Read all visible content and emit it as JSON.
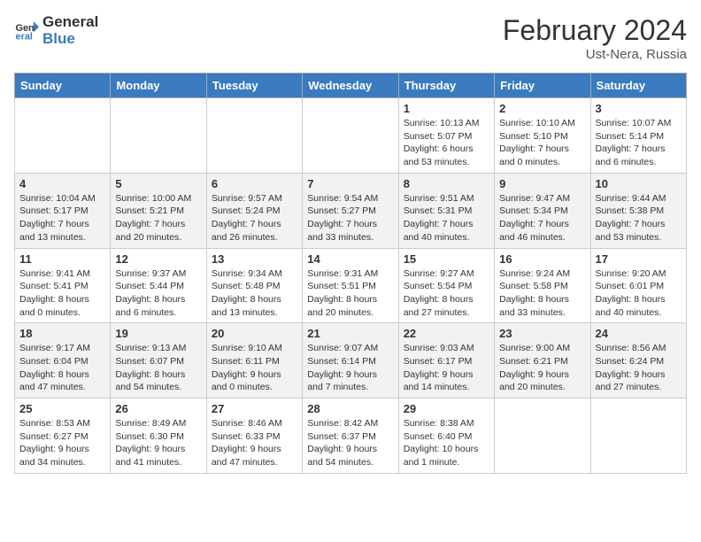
{
  "logo": {
    "line1": "General",
    "line2": "Blue"
  },
  "header": {
    "month": "February 2024",
    "location": "Ust-Nera, Russia"
  },
  "days_of_week": [
    "Sunday",
    "Monday",
    "Tuesday",
    "Wednesday",
    "Thursday",
    "Friday",
    "Saturday"
  ],
  "weeks": [
    [
      {
        "day": "",
        "info": ""
      },
      {
        "day": "",
        "info": ""
      },
      {
        "day": "",
        "info": ""
      },
      {
        "day": "",
        "info": ""
      },
      {
        "day": "1",
        "info": "Sunrise: 10:13 AM\nSunset: 5:07 PM\nDaylight: 6 hours\nand 53 minutes."
      },
      {
        "day": "2",
        "info": "Sunrise: 10:10 AM\nSunset: 5:10 PM\nDaylight: 7 hours\nand 0 minutes."
      },
      {
        "day": "3",
        "info": "Sunrise: 10:07 AM\nSunset: 5:14 PM\nDaylight: 7 hours\nand 6 minutes."
      }
    ],
    [
      {
        "day": "4",
        "info": "Sunrise: 10:04 AM\nSunset: 5:17 PM\nDaylight: 7 hours\nand 13 minutes."
      },
      {
        "day": "5",
        "info": "Sunrise: 10:00 AM\nSunset: 5:21 PM\nDaylight: 7 hours\nand 20 minutes."
      },
      {
        "day": "6",
        "info": "Sunrise: 9:57 AM\nSunset: 5:24 PM\nDaylight: 7 hours\nand 26 minutes."
      },
      {
        "day": "7",
        "info": "Sunrise: 9:54 AM\nSunset: 5:27 PM\nDaylight: 7 hours\nand 33 minutes."
      },
      {
        "day": "8",
        "info": "Sunrise: 9:51 AM\nSunset: 5:31 PM\nDaylight: 7 hours\nand 40 minutes."
      },
      {
        "day": "9",
        "info": "Sunrise: 9:47 AM\nSunset: 5:34 PM\nDaylight: 7 hours\nand 46 minutes."
      },
      {
        "day": "10",
        "info": "Sunrise: 9:44 AM\nSunset: 5:38 PM\nDaylight: 7 hours\nand 53 minutes."
      }
    ],
    [
      {
        "day": "11",
        "info": "Sunrise: 9:41 AM\nSunset: 5:41 PM\nDaylight: 8 hours\nand 0 minutes."
      },
      {
        "day": "12",
        "info": "Sunrise: 9:37 AM\nSunset: 5:44 PM\nDaylight: 8 hours\nand 6 minutes."
      },
      {
        "day": "13",
        "info": "Sunrise: 9:34 AM\nSunset: 5:48 PM\nDaylight: 8 hours\nand 13 minutes."
      },
      {
        "day": "14",
        "info": "Sunrise: 9:31 AM\nSunset: 5:51 PM\nDaylight: 8 hours\nand 20 minutes."
      },
      {
        "day": "15",
        "info": "Sunrise: 9:27 AM\nSunset: 5:54 PM\nDaylight: 8 hours\nand 27 minutes."
      },
      {
        "day": "16",
        "info": "Sunrise: 9:24 AM\nSunset: 5:58 PM\nDaylight: 8 hours\nand 33 minutes."
      },
      {
        "day": "17",
        "info": "Sunrise: 9:20 AM\nSunset: 6:01 PM\nDaylight: 8 hours\nand 40 minutes."
      }
    ],
    [
      {
        "day": "18",
        "info": "Sunrise: 9:17 AM\nSunset: 6:04 PM\nDaylight: 8 hours\nand 47 minutes."
      },
      {
        "day": "19",
        "info": "Sunrise: 9:13 AM\nSunset: 6:07 PM\nDaylight: 8 hours\nand 54 minutes."
      },
      {
        "day": "20",
        "info": "Sunrise: 9:10 AM\nSunset: 6:11 PM\nDaylight: 9 hours\nand 0 minutes."
      },
      {
        "day": "21",
        "info": "Sunrise: 9:07 AM\nSunset: 6:14 PM\nDaylight: 9 hours\nand 7 minutes."
      },
      {
        "day": "22",
        "info": "Sunrise: 9:03 AM\nSunset: 6:17 PM\nDaylight: 9 hours\nand 14 minutes."
      },
      {
        "day": "23",
        "info": "Sunrise: 9:00 AM\nSunset: 6:21 PM\nDaylight: 9 hours\nand 20 minutes."
      },
      {
        "day": "24",
        "info": "Sunrise: 8:56 AM\nSunset: 6:24 PM\nDaylight: 9 hours\nand 27 minutes."
      }
    ],
    [
      {
        "day": "25",
        "info": "Sunrise: 8:53 AM\nSunset: 6:27 PM\nDaylight: 9 hours\nand 34 minutes."
      },
      {
        "day": "26",
        "info": "Sunrise: 8:49 AM\nSunset: 6:30 PM\nDaylight: 9 hours\nand 41 minutes."
      },
      {
        "day": "27",
        "info": "Sunrise: 8:46 AM\nSunset: 6:33 PM\nDaylight: 9 hours\nand 47 minutes."
      },
      {
        "day": "28",
        "info": "Sunrise: 8:42 AM\nSunset: 6:37 PM\nDaylight: 9 hours\nand 54 minutes."
      },
      {
        "day": "29",
        "info": "Sunrise: 8:38 AM\nSunset: 6:40 PM\nDaylight: 10 hours\nand 1 minute."
      },
      {
        "day": "",
        "info": ""
      },
      {
        "day": "",
        "info": ""
      }
    ]
  ]
}
